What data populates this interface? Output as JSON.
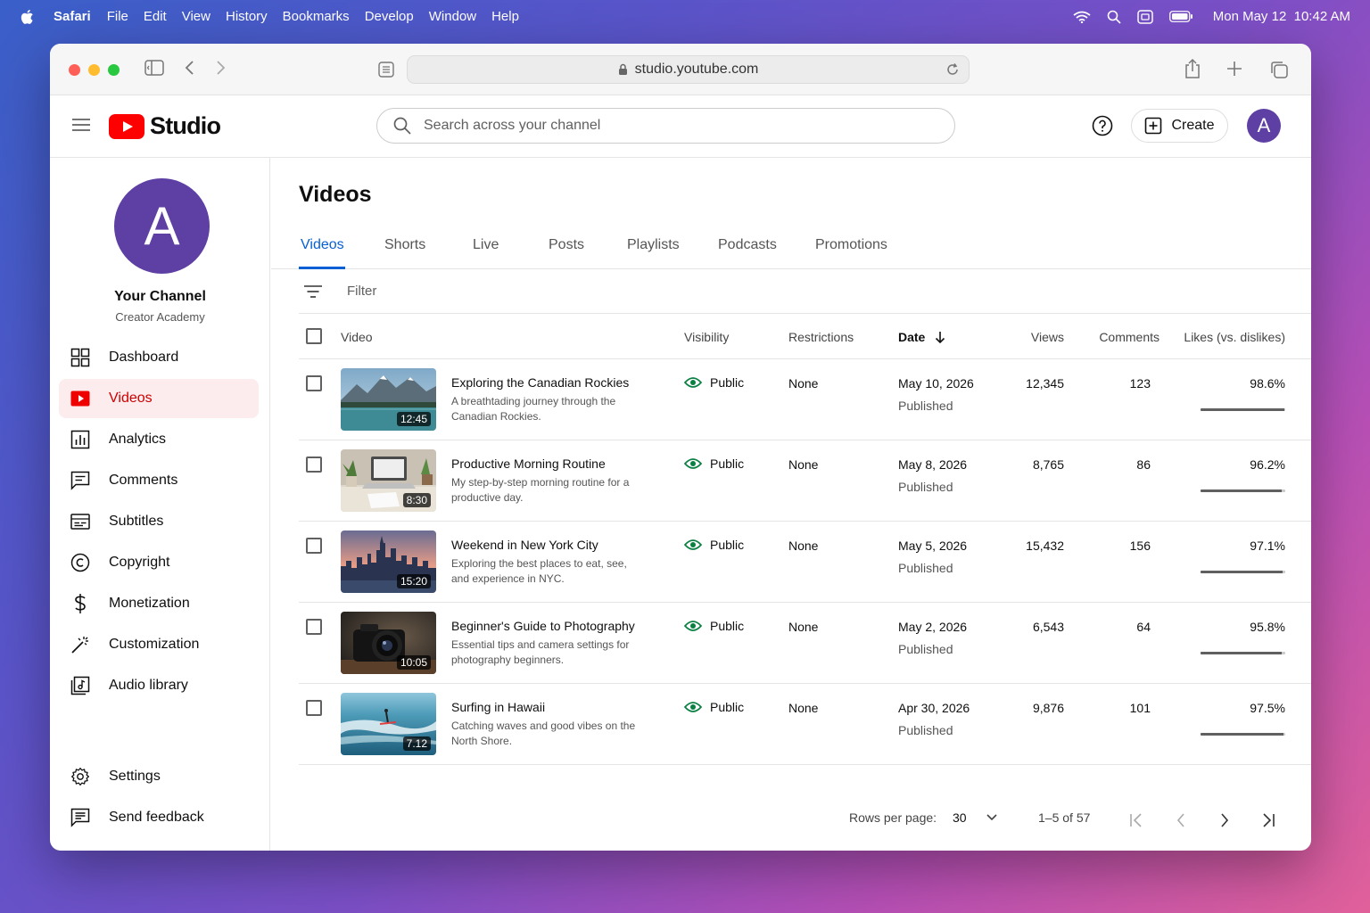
{
  "menubar": {
    "app": "Safari",
    "menus": [
      "File",
      "Edit",
      "View",
      "History",
      "Bookmarks",
      "Develop",
      "Window",
      "Help"
    ],
    "clock": "Mon May 12  10:42 AM"
  },
  "browser": {
    "url": "studio.youtube.com"
  },
  "header": {
    "logo_text": "Studio",
    "search_placeholder": "Search across your channel",
    "create_label": "Create",
    "avatar_letter": "A"
  },
  "channel": {
    "avatar_letter": "A",
    "name": "Your Channel",
    "subtitle": "Creator Academy"
  },
  "sidebar": {
    "items": [
      {
        "label": "Dashboard",
        "icon": "dashboard-icon"
      },
      {
        "label": "Videos",
        "icon": "videos-icon",
        "active": true
      },
      {
        "label": "Analytics",
        "icon": "analytics-icon"
      },
      {
        "label": "Comments",
        "icon": "comments-icon"
      },
      {
        "label": "Subtitles",
        "icon": "subtitles-icon"
      },
      {
        "label": "Copyright",
        "icon": "copyright-icon"
      },
      {
        "label": "Monetization",
        "icon": "dollar-icon"
      },
      {
        "label": "Customization",
        "icon": "magic-wand-icon"
      },
      {
        "label": "Audio library",
        "icon": "audio-library-icon"
      }
    ],
    "bottom": [
      {
        "label": "Settings",
        "icon": "gear-icon"
      },
      {
        "label": "Send feedback",
        "icon": "feedback-icon"
      }
    ]
  },
  "main": {
    "title": "Videos",
    "tabs": [
      "Videos",
      "Shorts",
      "Live",
      "Posts",
      "Playlists",
      "Podcasts",
      "Promotions"
    ],
    "filter_label": "Filter",
    "columns": {
      "video": "Video",
      "visibility": "Visibility",
      "restrictions": "Restrictions",
      "date": "Date",
      "views": "Views",
      "comments": "Comments",
      "likes": "Likes (vs. dislikes)"
    },
    "rows": [
      {
        "title": "Exploring the Canadian Rockies",
        "desc": "A breathtading journey through the Canadian Rockies.",
        "duration": "12:45",
        "visibility": "Public",
        "restrictions": "None",
        "date": "May 10, 2026",
        "status": "Published",
        "views": "12,345",
        "comments": "123",
        "likes": "98.6%",
        "likes_fraction": 0.986,
        "thumb": "mountain-lake"
      },
      {
        "title": "Productive Morning Routine",
        "desc": "My step-by-step morning routine for a productive day.",
        "duration": "8:30",
        "visibility": "Public",
        "restrictions": "None",
        "date": "May 8, 2026",
        "status": "Published",
        "views": "8,765",
        "comments": "86",
        "likes": "96.2%",
        "likes_fraction": 0.962,
        "thumb": "desk-laptop"
      },
      {
        "title": "Weekend in New York City",
        "desc": "Exploring the best places to eat, see, and experience in NYC.",
        "duration": "15:20",
        "visibility": "Public",
        "restrictions": "None",
        "date": "May 5, 2026",
        "status": "Published",
        "views": "15,432",
        "comments": "156",
        "likes": "97.1%",
        "likes_fraction": 0.971,
        "thumb": "city-skyline"
      },
      {
        "title": "Beginner's Guide to Photography",
        "desc": "Essential tips and camera settings for photography beginners.",
        "duration": "10:05",
        "visibility": "Public",
        "restrictions": "None",
        "date": "May 2, 2026",
        "status": "Published",
        "views": "6,543",
        "comments": "64",
        "likes": "95.8%",
        "likes_fraction": 0.958,
        "thumb": "camera"
      },
      {
        "title": "Surfing in Hawaii",
        "desc": "Catching waves and good vibes on the North Shore.",
        "duration": "7.12",
        "visibility": "Public",
        "restrictions": "None",
        "date": "Apr 30, 2026",
        "status": "Published",
        "views": "9,876",
        "comments": "101",
        "likes": "97.5%",
        "likes_fraction": 0.975,
        "thumb": "surfer"
      }
    ]
  },
  "pagination": {
    "rows_per_page_label": "Rows per page:",
    "rows_per_page": "30",
    "range": "1–5 of 57"
  },
  "colors": {
    "accent_blue": "#065fd4",
    "youtube_red": "#ff0000",
    "avatar_purple": "#5e3fa3",
    "public_green": "#0b8043"
  }
}
